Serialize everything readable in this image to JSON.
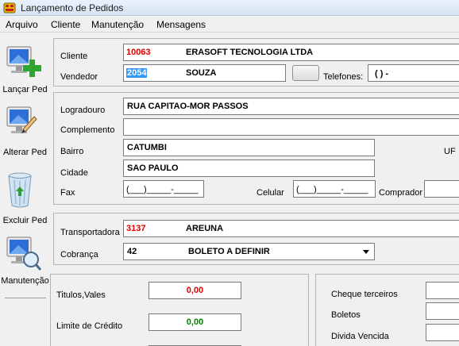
{
  "window": {
    "title": "Lançamento de Pedidos"
  },
  "menu": [
    "Arquivo",
    "Cliente",
    "Manutenção",
    "Mensagens"
  ],
  "sidebar": [
    {
      "label": "Lançar Ped",
      "icon": "monitor-add-icon"
    },
    {
      "label": "Alterar Ped",
      "icon": "monitor-edit-icon"
    },
    {
      "label": "Excluir Ped",
      "icon": "recycle-bin-icon"
    },
    {
      "label": "Manutenção",
      "icon": "monitor-search-icon"
    }
  ],
  "customer": {
    "cliente_label": "Cliente",
    "cliente_code": "10063",
    "cliente_name": "ERASOFT TECNOLOGIA LTDA",
    "vendedor_label": "Vendedor",
    "vendedor_code": "2054",
    "vendedor_name": "SOUZA",
    "telefones_label": "Telefones:",
    "telefones_value": "(   )      -"
  },
  "address": {
    "logradouro_label": "Logradouro",
    "logradouro_value": "RUA CAPITAO-MOR PASSOS",
    "complemento_label": "Complemento",
    "complemento_value": "",
    "bairro_label": "Bairro",
    "bairro_value": "CATUMBI",
    "uf_label": "UF",
    "cidade_label": "Cidade",
    "cidade_value": "SAO PAULO",
    "fax_label": "Fax",
    "fax_value": "(___)_____-_____",
    "celular_label": "Celular",
    "celular_value": "(___)_____-_____",
    "comprador_label": "Comprador",
    "comprador_value": ""
  },
  "shipping": {
    "transportadora_label": "Transportadora",
    "transportadora_code": "3137",
    "transportadora_name": "AREUNA",
    "cobranca_label": "Cobrança",
    "cobranca_code": "42",
    "cobranca_name": "BOLETO A DEFINIR"
  },
  "financial": {
    "titulos_label": "Titulos,Vales",
    "titulos_value": "0,00",
    "titulos_color": "#e00000",
    "limite_label": "Limite de Crédito",
    "limite_value": "0,00",
    "limite_color": "#008000",
    "cheque_label": "Cheque terceiros",
    "boletos_label": "Boletos",
    "divida_label": "Divida Vencida"
  }
}
